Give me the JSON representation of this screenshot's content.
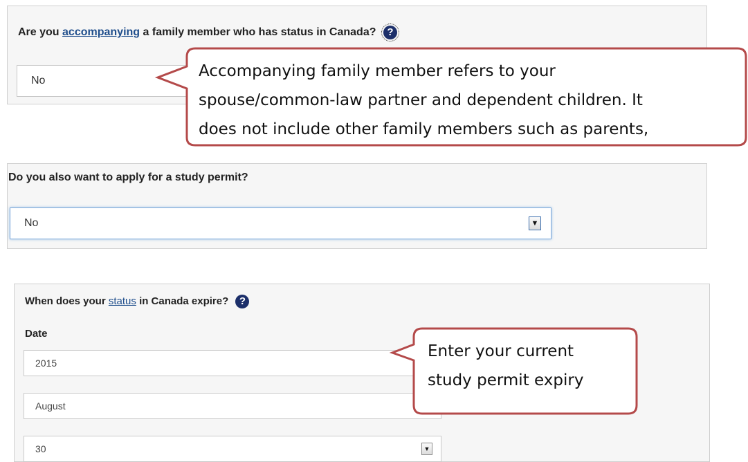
{
  "q1": {
    "prefix": "Are you",
    "link": "accompanying",
    "suffix": "a family member who has status in Canada?",
    "help_icon": "question-circle-icon",
    "value": "No"
  },
  "callout1": {
    "line1": "Accompanying family member refers to your",
    "line2": "spouse/common-law partner and dependent children. It",
    "line3": "does not include other family members such as parents,"
  },
  "q2": {
    "question": "Do you also want to apply for a study permit?",
    "value": "No"
  },
  "q3": {
    "prefix": "When does your",
    "link": "status",
    "suffix": "in Canada expire?",
    "date_label": "Date",
    "year": "2015",
    "month": "August",
    "day": "30"
  },
  "callout2": {
    "line1": "Enter your current",
    "line2": "study permit expiry"
  },
  "colors": {
    "callout_border": "#b44a4a",
    "link": "#1f4e8c",
    "help_icon": "#1c2f6a"
  }
}
